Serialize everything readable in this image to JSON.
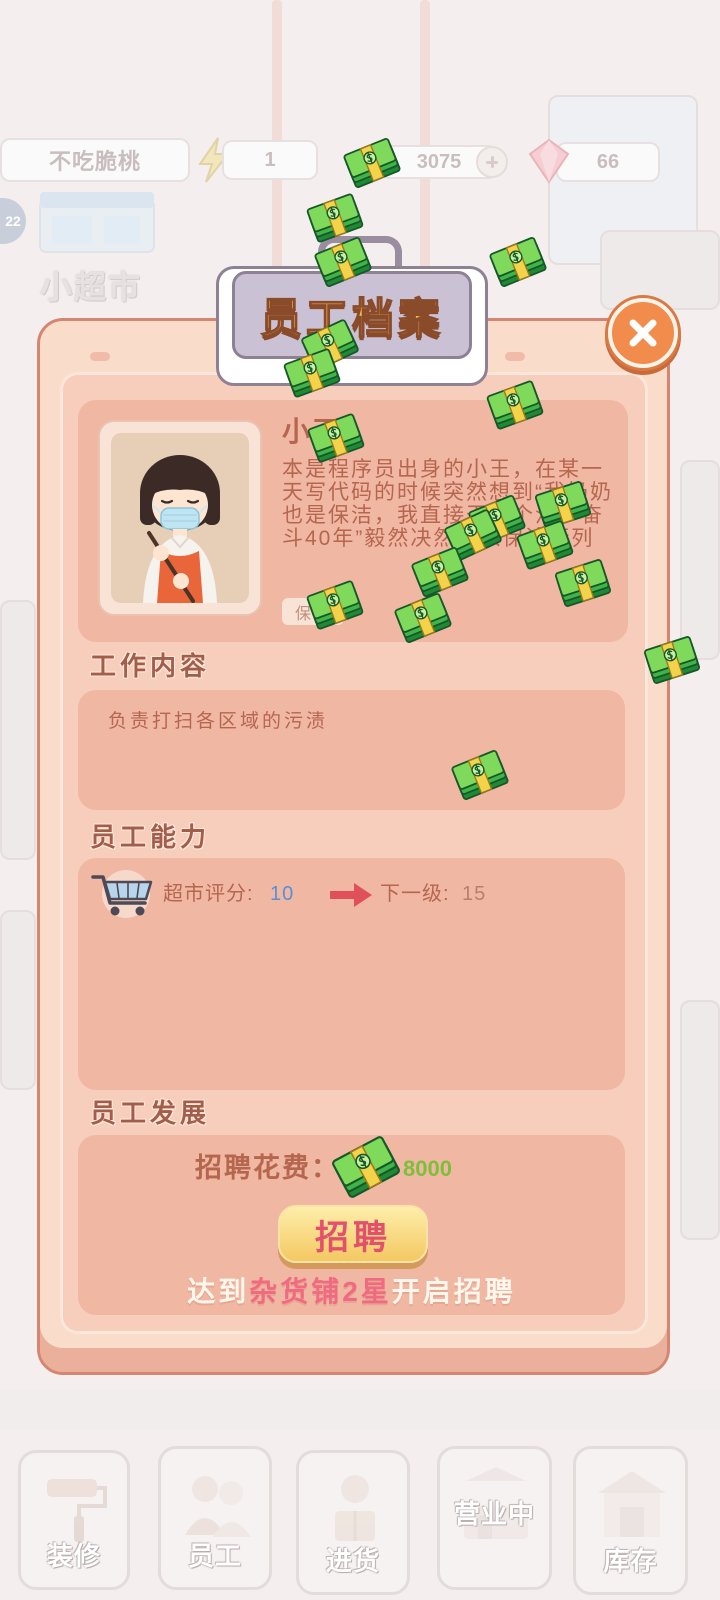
{
  "background": {
    "player_name": "不吃脆桃",
    "energy_value": "1",
    "coins": "3075",
    "gems": "66",
    "level": "22",
    "store_name": "小超市",
    "icons": {
      "energy": "lightning-icon",
      "gem": "gem-icon",
      "add_coins": "plus-icon",
      "store": "shop-icon"
    },
    "nav": [
      {
        "label": "装修",
        "icon": "paint-roller-icon"
      },
      {
        "label": "员工",
        "icon": "staff-icon"
      },
      {
        "label": "进货",
        "icon": "restock-icon"
      },
      {
        "label": "营业中",
        "icon": "shop-sign-icon"
      },
      {
        "label": "库存",
        "icon": "warehouse-icon"
      }
    ]
  },
  "modal": {
    "title": "员工档案",
    "close_icon": "close-icon",
    "profile": {
      "name": "小王",
      "bio": "本是程序员出身的小王，在某一天写代码的时候突然想到“我奶奶也是保洁，我直接干这个活少奋斗40年”毅然决然加入保洁行列",
      "role_tag": "保洁"
    },
    "work": {
      "heading": "工作内容",
      "description": "负责打扫各区域的污渍"
    },
    "ability": {
      "heading": "员工能力",
      "rating_icon": "shopping-cart-icon",
      "rating_label": "超市评分:",
      "rating_value": "10",
      "arrow_icon": "arrow-right-icon",
      "next_label": "下一级:",
      "next_value": "15"
    },
    "development": {
      "heading": "员工发展",
      "cost_label": "招聘花费：",
      "cost_icon": "cash-stack-icon",
      "cost_value": "8000",
      "hire_button": "招聘",
      "requirement": {
        "prefix": "达到",
        "highlight": "杂货铺2星",
        "suffix": "开启招聘"
      }
    }
  },
  "effects": {
    "flying_cash_icon": "cash-stack-icon"
  },
  "colors": {
    "modal_frame": "#fadccb",
    "modal_bg": "#f6cebb",
    "section_bg": "#f0b7a3",
    "heading_text": "#a35d4b",
    "body_text": "#b5664f",
    "rating_value": "#5b8fd9",
    "cost_value": "#7cbf3a",
    "hire_text": "#e4506b",
    "highlight_text": "#f06a82",
    "close_button": "#f28c4d",
    "title_text": "#f8c24b"
  }
}
